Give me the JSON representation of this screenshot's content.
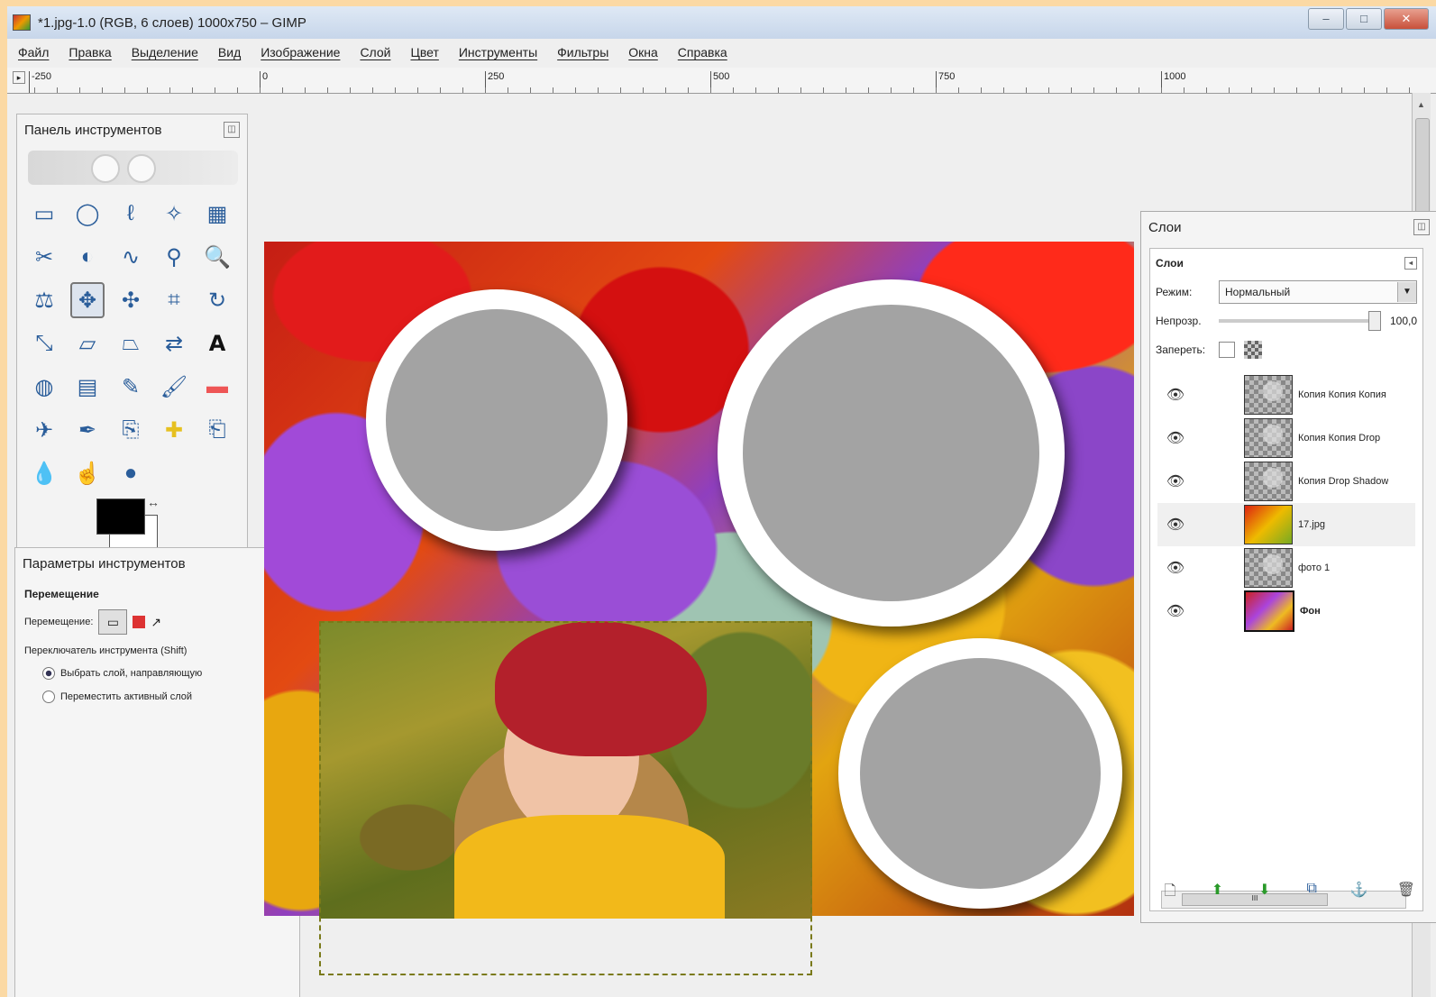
{
  "window": {
    "title": "*1.jpg-1.0 (RGB, 6 слоев) 1000x750 – GIMP",
    "controls": [
      "–",
      "□",
      "✕"
    ]
  },
  "menu": [
    "Файл",
    "Правка",
    "Выделение",
    "Вид",
    "Изображение",
    "Слой",
    "Цвет",
    "Инструменты",
    "Фильтры",
    "Окна",
    "Справка"
  ],
  "ruler": {
    "labels": [
      "-250",
      "0",
      "250",
      "500",
      "750",
      "1000"
    ]
  },
  "toolbox": {
    "title": "Панель инструментов",
    "tools": [
      "rect-select",
      "ellipse-select",
      "free-select",
      "fuzzy-select",
      "color-select",
      "scissors",
      "foreground-select",
      "paths",
      "color-picker",
      "zoom",
      "measure",
      "move",
      "align",
      "crop",
      "rotate",
      "scale",
      "shear",
      "perspective",
      "flip",
      "text",
      "bucket-fill",
      "blend",
      "pencil",
      "paintbrush",
      "eraser",
      "airbrush",
      "ink",
      "clone",
      "heal",
      "perspective-clone",
      "blur",
      "smudge",
      "dodge-burn"
    ],
    "active_tool": "move",
    "fg_color": "#000000",
    "bg_color": "#ffffff"
  },
  "tool_options": {
    "title": "Параметры инструментов",
    "section": "Перемещение",
    "move_label": "Перемещение:",
    "switch_label": "Переключатель инструмента (Shift)",
    "radio_pick_layer": "Выбрать слой, направляющую",
    "radio_move_active": "Переместить активный слой",
    "selected_radio": 0
  },
  "layers_panel": {
    "title": "Слои",
    "section": "Слои",
    "mode_label": "Режим:",
    "mode_value": "Нормальный",
    "opacity_label": "Непрозр.",
    "opacity_value": "100,0",
    "lock_label": "Запереть:",
    "layers": [
      {
        "name": "Копия Копия Копия",
        "type": "circle"
      },
      {
        "name": "Копия Копия Drop",
        "type": "circle"
      },
      {
        "name": "Копия Drop Shadow",
        "type": "circle"
      },
      {
        "name": "17.jpg",
        "type": "photo"
      },
      {
        "name": "фото 1",
        "type": "circle"
      },
      {
        "name": "Фон",
        "type": "bg"
      }
    ],
    "selected_layer": 3,
    "scroll_label": "III"
  },
  "colors": {
    "circle_fill": "#a3a3a3",
    "frame": "#ffffff",
    "selection_border": "#7a7a1a"
  }
}
